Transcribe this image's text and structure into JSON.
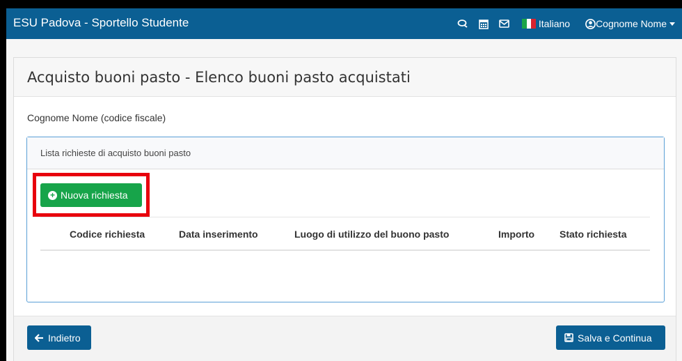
{
  "app": {
    "title": "ESU Padova - Sportello Studente"
  },
  "navbar": {
    "icons": [
      "chat-icon",
      "calendar-icon",
      "envelope-icon"
    ],
    "language": "Italiano",
    "user": "Cognome Nome",
    "colors": {
      "bar": "#0b5f93",
      "flag_green": "#1ba548",
      "flag_white": "#ffffff",
      "flag_red": "#d9232e"
    }
  },
  "page": {
    "title": "Acquisto buoni pasto - Elenco buoni pasto acquistati",
    "person_label": "Cognome Nome (codice fiscale)"
  },
  "panel": {
    "heading": "Lista richieste di acquisto buoni pasto",
    "new_button": "Nuova richiesta",
    "columns": [
      "Codice richiesta",
      "Data inserimento",
      "Luogo di utilizzo del buono pasto",
      "Importo",
      "Stato richiesta"
    ],
    "rows": []
  },
  "footer": {
    "back_button": "Indietro",
    "save_button": "Salva e Continua"
  },
  "colors": {
    "primary": "#0b5f93",
    "success": "#17a44a",
    "highlight": "#e8000d"
  }
}
